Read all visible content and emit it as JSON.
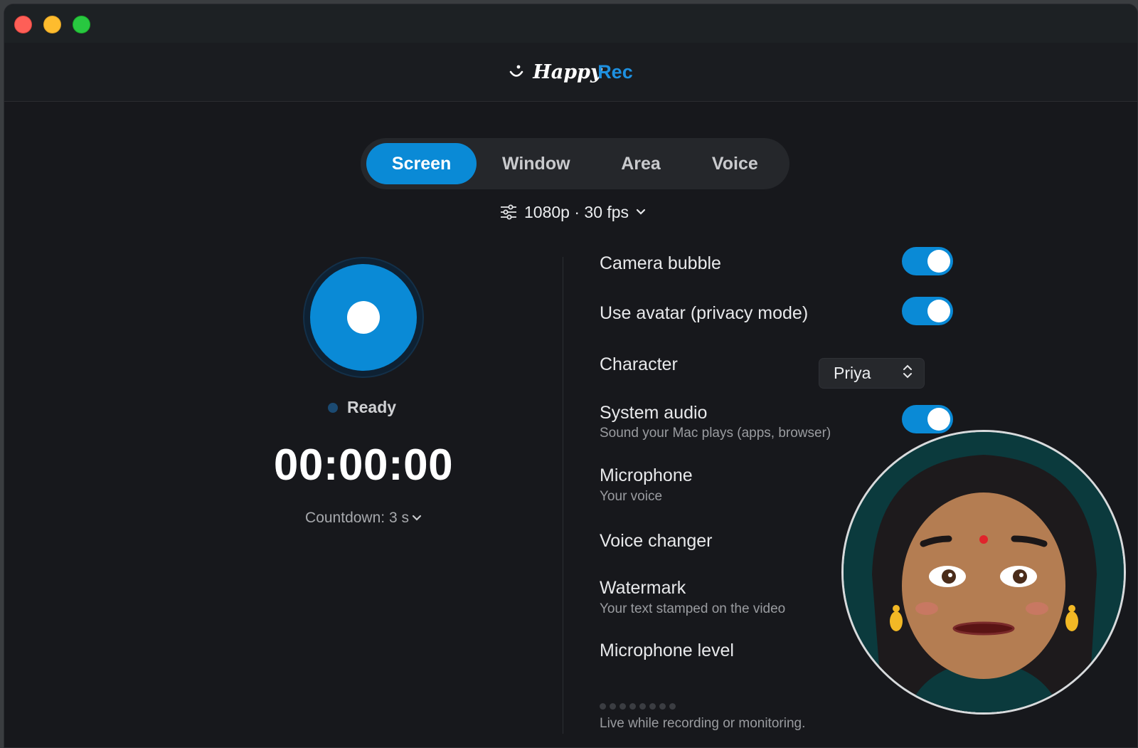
{
  "app": {
    "brand_part1": "Happy",
    "brand_part2": "Rec",
    "accent_color": "#0a8ad6",
    "brand_rec_color": "#1e90e0"
  },
  "tabs": [
    {
      "label": "Screen",
      "active": true
    },
    {
      "label": "Window",
      "active": false
    },
    {
      "label": "Area",
      "active": false
    },
    {
      "label": "Voice",
      "active": false
    }
  ],
  "quality": {
    "label": "1080p · 30 fps",
    "icon": "sliders-icon"
  },
  "recorder": {
    "status": "Ready",
    "timer": "00:00:00",
    "countdown": "Countdown: 3 s"
  },
  "settings": {
    "camera_bubble": {
      "label": "Camera bubble",
      "enabled": true
    },
    "use_avatar": {
      "label": "Use avatar (privacy mode)",
      "enabled": true
    },
    "character": {
      "label": "Character",
      "value": "Priya"
    },
    "system_audio": {
      "label": "System audio",
      "sublabel": "Sound your Mac plays (apps, browser)",
      "enabled": true
    },
    "microphone": {
      "label": "Microphone",
      "sublabel": "Your voice"
    },
    "voice_changer": {
      "label": "Voice changer"
    },
    "watermark": {
      "label": "Watermark",
      "sublabel": "Your text stamped on the video"
    },
    "microphone_level": {
      "label": "Microphone level",
      "hint": "Live while recording or monitoring.",
      "level": 0
    }
  }
}
